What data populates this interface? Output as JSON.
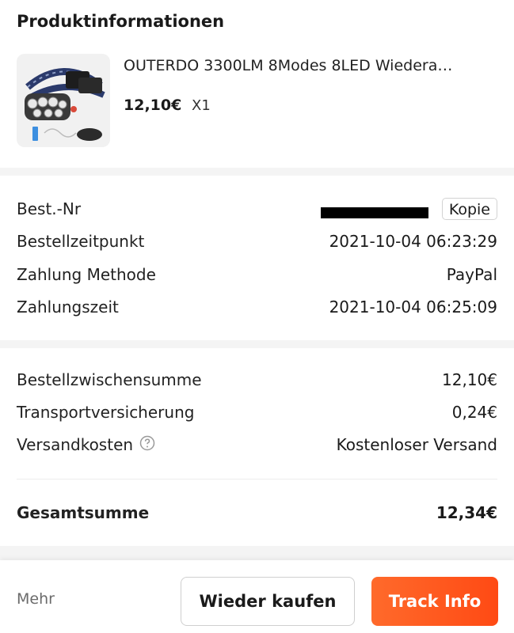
{
  "product_section": {
    "title": "Produktinformationen",
    "product": {
      "name": "OUTERDO 3300LM 8Modes 8LED Wiedera…",
      "price": "12,10€",
      "quantity": "X1",
      "thumbnail": "headlamp-product-image"
    }
  },
  "order_info": {
    "order_number": {
      "label": "Best.-Nr",
      "value_redacted": true,
      "copy_label": "Kopie"
    },
    "order_time": {
      "label": "Bestellzeitpunkt",
      "value": "2021-10-04 06:23:29"
    },
    "payment_method": {
      "label": "Zahlung Methode",
      "value": "PayPal"
    },
    "payment_time": {
      "label": "Zahlungszeit",
      "value": "2021-10-04 06:25:09"
    }
  },
  "summary": {
    "subtotal": {
      "label": "Bestellzwischensumme",
      "value": "12,10€"
    },
    "insurance": {
      "label": "Transportversicherung",
      "value": "0,24€"
    },
    "shipping": {
      "label": "Versandkosten",
      "value": "Kostenloser Versand",
      "icon": "help-circle-icon"
    },
    "total": {
      "label": "Gesamtsumme",
      "value": "12,34€"
    }
  },
  "bottom_bar": {
    "more_label": "Mehr",
    "rebuy_label": "Wieder kaufen",
    "track_label": "Track Info",
    "accent_color": "#ff5a1f"
  }
}
